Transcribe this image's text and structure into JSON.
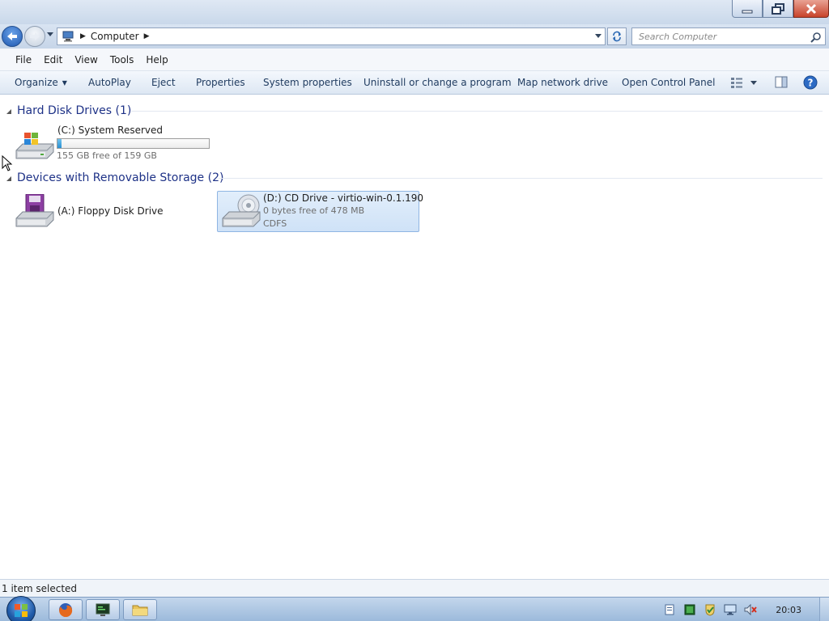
{
  "window": {
    "title": "Computer"
  },
  "address": {
    "crumbs": [
      "Computer"
    ],
    "search_placeholder": "Search Computer"
  },
  "menubar": {
    "items": [
      "File",
      "Edit",
      "View",
      "Tools",
      "Help"
    ]
  },
  "toolbar": {
    "organize": "Organize",
    "autoplay": "AutoPlay",
    "eject": "Eject",
    "properties": "Properties",
    "system_properties": "System properties",
    "uninstall": "Uninstall or change a program",
    "map_drive": "Map network drive",
    "control_panel": "Open Control Panel"
  },
  "groups": {
    "hdd": {
      "title": "Hard Disk Drives (1)",
      "drives": [
        {
          "name": "(C:) System Reserved",
          "free": "155 GB free of 159 GB",
          "used_fraction": 0.025,
          "icon": "windows-drive-icon"
        }
      ]
    },
    "removable": {
      "title": "Devices with Removable Storage (2)",
      "drives": [
        {
          "name": "(A:) Floppy Disk Drive",
          "icon": "floppy-drive-icon"
        },
        {
          "name": "(D:) CD Drive - virtio-win-0.1.190",
          "free": "0 bytes free of 478 MB",
          "fs": "CDFS",
          "icon": "cd-drive-icon",
          "selected": true
        }
      ]
    }
  },
  "status": {
    "text": "1 item selected"
  },
  "taskbar": {
    "clock": "20:03",
    "pinned": [
      "firefox-icon",
      "terminal-icon",
      "folder-icon"
    ],
    "tray": [
      "document-icon",
      "network-icon",
      "shield-check-icon",
      "monitor-icon",
      "speaker-muted-icon"
    ]
  },
  "colors": {
    "accent": "#1e3287",
    "selection": "#cfe2f7",
    "usage_fill": "#2b90d2"
  }
}
